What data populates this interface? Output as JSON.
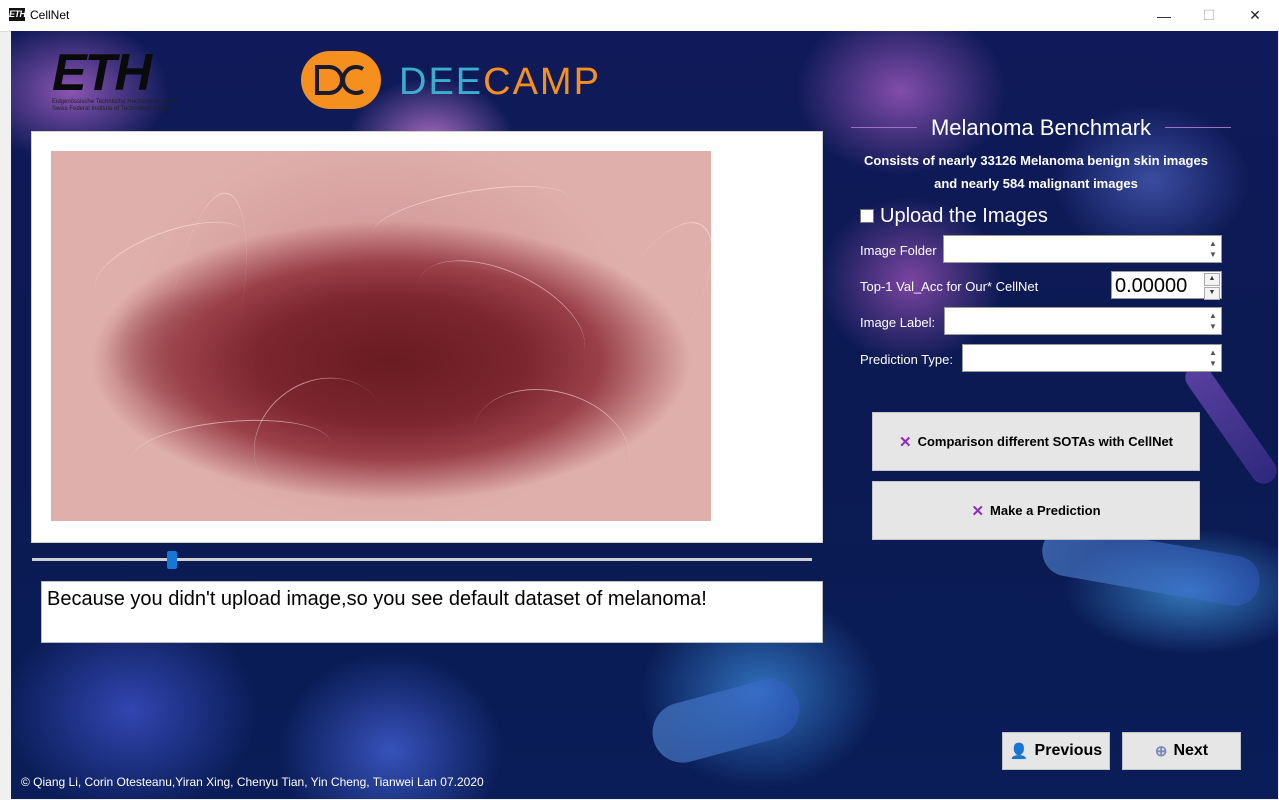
{
  "window": {
    "title": "CellNet",
    "icon_text": "ETH",
    "minimize_glyph": "—",
    "maximize_glyph": "☐",
    "close_glyph": "✕"
  },
  "logos": {
    "eth": {
      "word": "ETH",
      "line1": "Eidgenössische Technische Hochschule Zürich",
      "line2": "Swiss Federal Institute of Technology Zurich"
    },
    "deecamp": {
      "dee": "DEE",
      "camp": "CAMP"
    }
  },
  "message": "Because you didn't upload image,so you see default dataset of melanoma!",
  "slider": {
    "value_fraction": 0.18
  },
  "benchmark": {
    "title": "Melanoma Benchmark",
    "line1": "Consists of nearly 33126 Melanoma benign skin  images",
    "line2": "and  nearly 584  malignant  images"
  },
  "upload": {
    "label": "Upload the Images",
    "checked": false
  },
  "fields": {
    "image_folder": {
      "label": "Image Folder",
      "value": ""
    },
    "top1": {
      "label": "Top-1 Val_Acc for Our* CellNet",
      "value": "0.00000"
    },
    "image_label": {
      "label": "Image Label:",
      "value": ""
    },
    "prediction_type": {
      "label": "Prediction Type:",
      "value": ""
    }
  },
  "buttons": {
    "compare": "Comparison different SOTAs with CellNet",
    "predict": "Make a Prediction",
    "previous": "Previous",
    "next": "Next"
  },
  "footer": "© Qiang Li, Corin Otesteanu,Yiran Xing, Chenyu Tian, Yin Cheng, Tianwei Lan 07.2020",
  "colors": {
    "accent": "#8a2ec0",
    "slider": "#1478d4",
    "deecamp_orange": "#f5901e",
    "deecamp_blue": "#3aaecf"
  }
}
